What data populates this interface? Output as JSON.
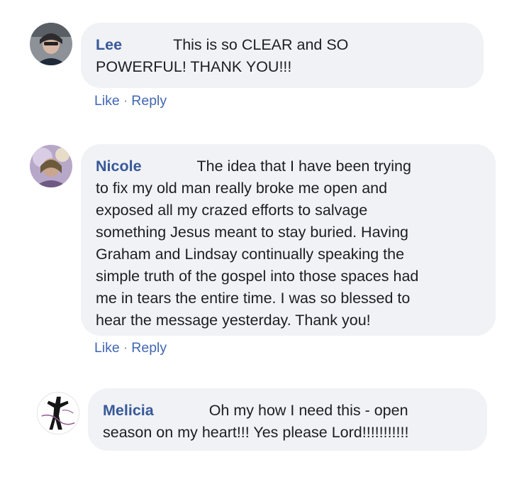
{
  "comments": [
    {
      "author": "Lee",
      "first_line_text": "This is so CLEAR and SO",
      "lines": [
        "POWERFUL! THANK YOU!!!"
      ],
      "like_label": "Like",
      "separator": "·",
      "reply_label": "Reply"
    },
    {
      "author": "Nicole",
      "first_line_text": "The idea that I have been trying",
      "lines": [
        "to fix my old man really broke me open and",
        "exposed all my crazed efforts to salvage",
        "something Jesus meant to stay buried. Having",
        "Graham and Lindsay continually speaking the",
        "simple truth of the gospel into those spaces had",
        "me in tears the entire time. I was so blessed to",
        "hear the message yesterday. Thank you!"
      ],
      "like_label": "Like",
      "separator": "·",
      "reply_label": "Reply"
    },
    {
      "author": "Melicia",
      "first_line_text": "Oh my how I need this - open",
      "lines": [
        "season on my heart!!! Yes please Lord!!!!!!!!!!!"
      ]
    }
  ],
  "colors": {
    "bubble_bg": "#f0f2f5",
    "author": "#385898",
    "link": "#4267b2",
    "text": "#1c1e21"
  }
}
